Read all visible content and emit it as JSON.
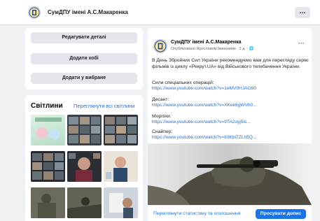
{
  "topbar": {
    "page_name": "СумДПУ імені А.С.Макаренка",
    "more_icon": "…"
  },
  "left_card": {
    "buttons": [
      "Редагувати деталі",
      "Додати хобі",
      "Додати у вибране"
    ]
  },
  "photos": {
    "title": "Світлини",
    "see_all": "Переглянути всі світлини"
  },
  "post": {
    "author": "СумДПУ імені А.С.Макаренка",
    "meta": "Опубліковано Ярославом Іванковим · 2 д. · 🌐",
    "dots": "···",
    "intro": "В День Збройних Сил України рекомендуємо вам для перегляду серію фільмів із циклу «Рекрут.UA» від Військового телебачення України.",
    "items": [
      {
        "label": "Сили спеціальних операцій:",
        "url": "https://www.youtube.com/watch?v=1eMV0HJAO80"
      },
      {
        "label": "Десант:",
        "url": "https://www.youtube.com/watch?v=XKek6gWVh0..."
      },
      {
        "label": "Морпіхи:",
        "url": "https://www.youtube.com/watch?v=9TA2uyj5ls..."
      },
      {
        "label": "Снайпер:",
        "url": "https://www.youtube.com/watch?v=83Kbi7ZLh5Q..."
      }
    ],
    "stats_link": "Переглянути статистику та оголошення",
    "promote_button": "Просувати допис"
  },
  "colors": {
    "accent": "#1b74e4",
    "link": "#216fdb",
    "background": "#f0f2f5"
  }
}
